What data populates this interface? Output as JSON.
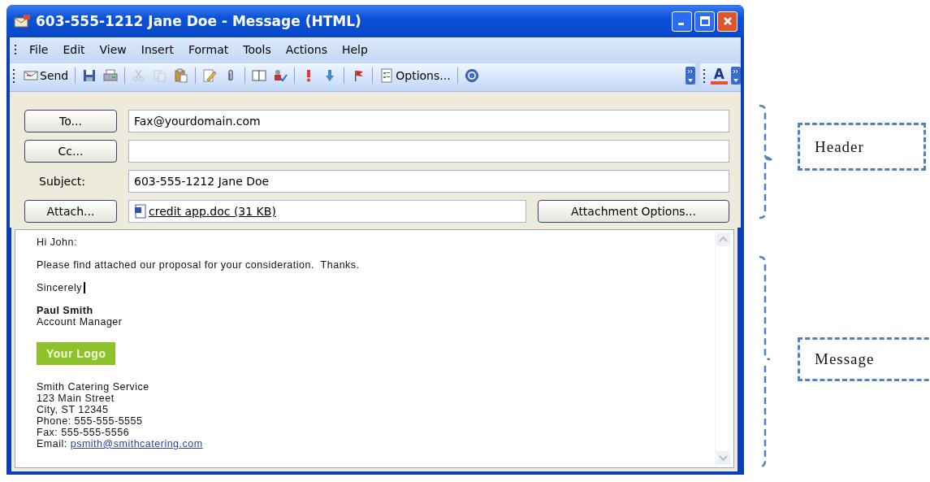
{
  "window": {
    "title": "603-555-1212 Jane Doe - Message (HTML)"
  },
  "menu": [
    "File",
    "Edit",
    "View",
    "Insert",
    "Format",
    "Tools",
    "Actions",
    "Help"
  ],
  "toolbar": {
    "groups": [
      [
        {
          "kind": "send",
          "label": "Send",
          "disabled": false
        }
      ],
      [
        {
          "kind": "save",
          "disabled": false
        },
        {
          "kind": "print",
          "disabled": false
        }
      ],
      [
        {
          "kind": "cut",
          "disabled": true
        },
        {
          "kind": "copy",
          "disabled": true
        },
        {
          "kind": "paste",
          "disabled": false
        }
      ],
      [
        {
          "kind": "edit",
          "disabled": false
        },
        {
          "kind": "attach",
          "disabled": false
        }
      ],
      [
        {
          "kind": "book",
          "disabled": false
        },
        {
          "kind": "check",
          "disabled": false
        }
      ],
      [
        {
          "kind": "high",
          "disabled": false
        },
        {
          "kind": "low",
          "disabled": false
        }
      ],
      [
        {
          "kind": "flag",
          "disabled": false
        }
      ],
      [
        {
          "kind": "options",
          "label": "Options...",
          "disabled": false
        }
      ],
      [
        {
          "kind": "help",
          "disabled": false
        }
      ]
    ],
    "font_color": {
      "label": "A",
      "color": "#e8502a"
    }
  },
  "header": {
    "to": {
      "button": "To...",
      "value": "Fax@yourdomain.com"
    },
    "cc": {
      "button": "Cc..."
    },
    "subject": {
      "label": "Subject:",
      "value": "603-555-1212 Jane Doe"
    },
    "attach": {
      "button": "Attach...",
      "file": "credit app.doc (31 KB)",
      "options_button": "Attachment Options..."
    }
  },
  "message": {
    "greeting": "Hi John:",
    "body": "Please find attached our proposal for your consideration.  Thanks.",
    "closing": "Sincerely",
    "name": "Paul Smith",
    "role": "Account Manager",
    "logo": "Your Logo",
    "address": [
      "Smith Catering Service",
      "123 Main Street",
      "City, ST 12345",
      "Phone: 555-555-5555",
      "Fax: 555-555-5556"
    ],
    "email_label": "Email:",
    "email": "psmith@smithcatering.com"
  },
  "annotations": [
    {
      "label": "Header"
    },
    {
      "label": "Message"
    }
  ]
}
